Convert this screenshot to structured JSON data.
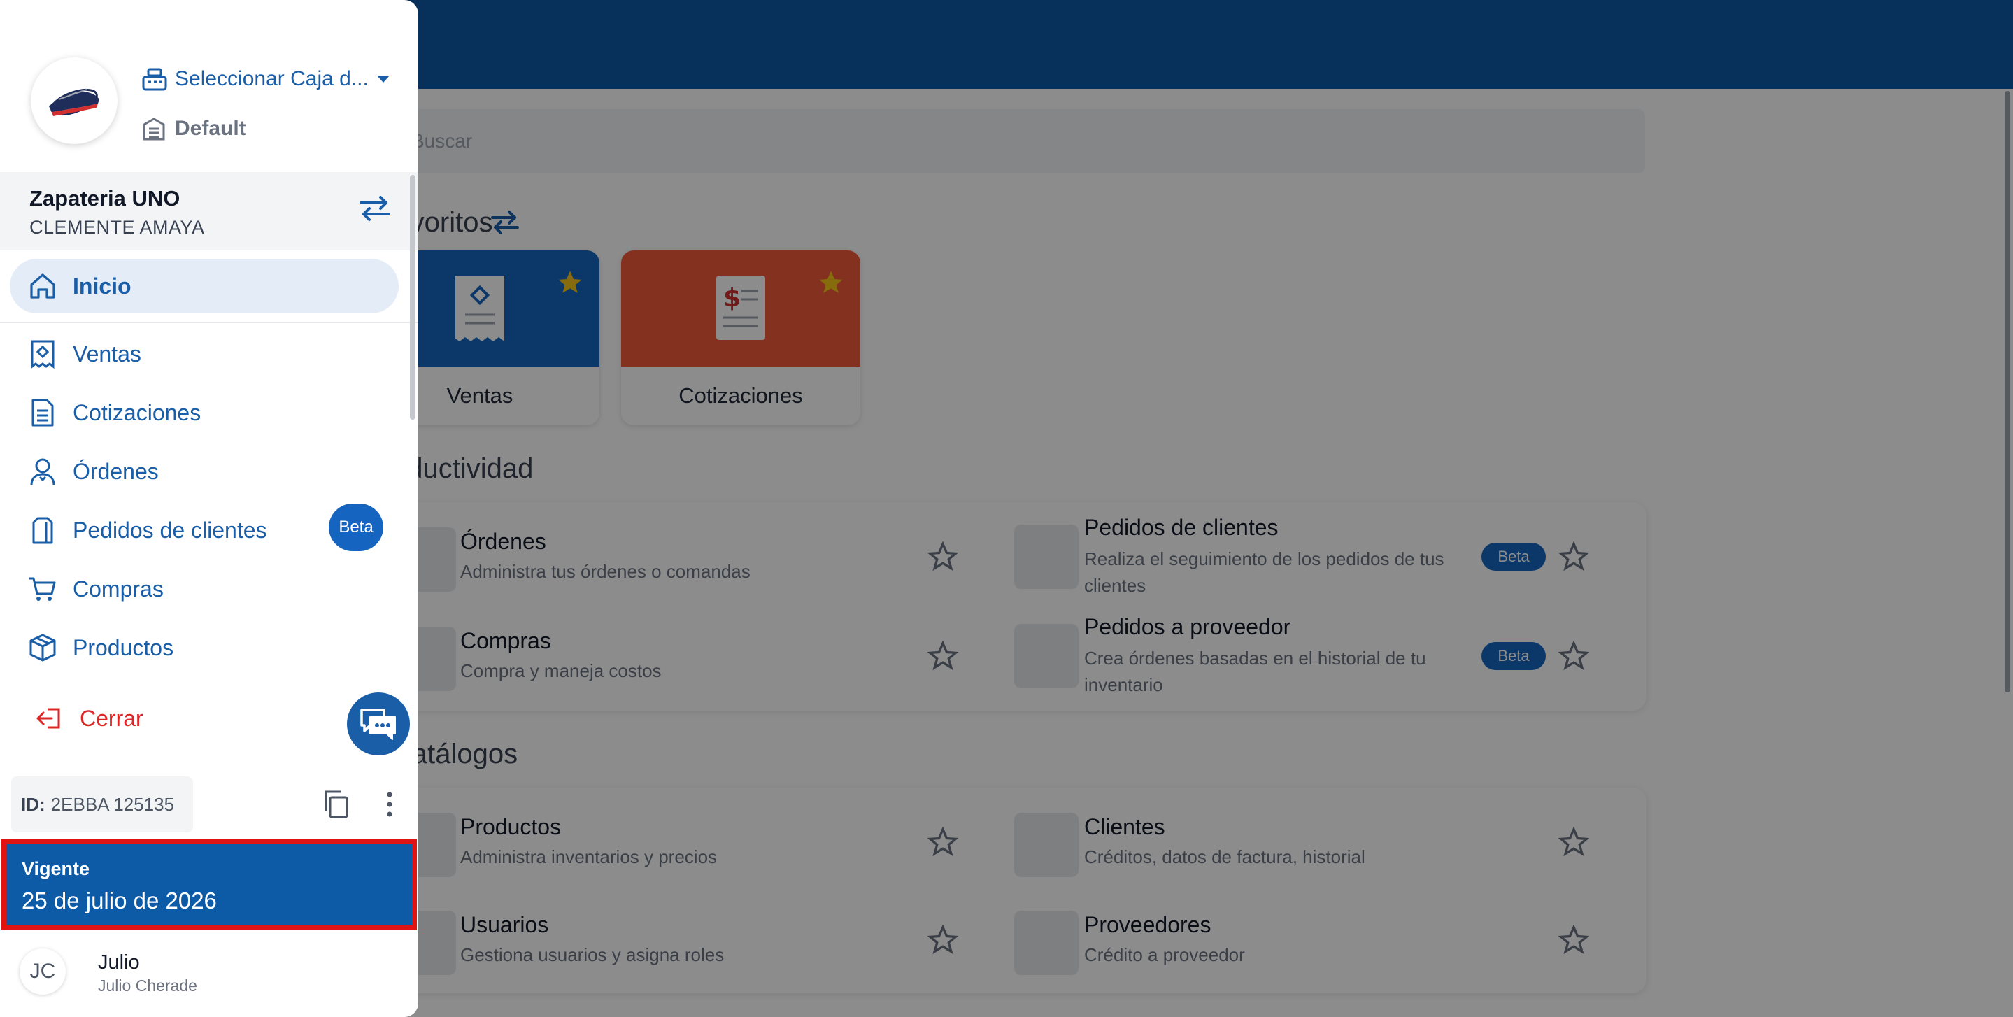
{
  "colors": {
    "primary": "#0d5aa7",
    "accent": "#1a5ea8",
    "danger": "#dc2626",
    "highlight": "#e11414"
  },
  "main": {
    "search_placeholder": "Buscar",
    "favoritos_title": "Favoritos",
    "favorites": [
      {
        "label": "Ventas",
        "color": "#1565c0",
        "icon": "receipt-icon"
      },
      {
        "label": "Cotizaciones",
        "color": "#f05a3a",
        "icon": "quote-doc-icon"
      }
    ],
    "productividad_title": "Productividad",
    "productividad": [
      {
        "title": "Órdenes",
        "desc": "Administra tus órdenes o comandas"
      },
      {
        "title": "Pedidos de clientes",
        "desc": "Realiza el seguimiento de los pedidos de tus clientes",
        "badge": "Beta"
      },
      {
        "title": "Compras",
        "desc": "Compra y maneja costos"
      },
      {
        "title": "Pedidos a proveedor",
        "desc": "Crea órdenes basadas en el historial de tu inventario",
        "badge": "Beta"
      }
    ],
    "catalogos_title": "Catálogos",
    "catalogos": [
      {
        "title": "Productos",
        "desc": "Administra inventarios y precios"
      },
      {
        "title": "Clientes",
        "desc": "Créditos, datos de factura, historial"
      },
      {
        "title": "Usuarios",
        "desc": "Gestiona usuarios y asigna roles"
      },
      {
        "title": "Proveedores",
        "desc": "Crédito a proveedor"
      }
    ]
  },
  "drawer": {
    "caja_select": "Seleccionar Caja d...",
    "default_label": "Default",
    "company_name": "Zapateria UNO",
    "company_user": "CLEMENTE AMAYA",
    "nav": [
      {
        "label": "Inicio",
        "icon": "home-icon",
        "active": true
      },
      {
        "label": "Ventas",
        "icon": "receipt-icon"
      },
      {
        "label": "Cotizaciones",
        "icon": "document-icon"
      },
      {
        "label": "Órdenes",
        "icon": "waiter-icon"
      },
      {
        "label": "Pedidos de clientes",
        "icon": "bag-icon",
        "badge": "Beta"
      },
      {
        "label": "Compras",
        "icon": "cart-icon"
      },
      {
        "label": "Productos",
        "icon": "box-icon"
      }
    ],
    "cerrar_label": "Cerrar",
    "id_label": "ID:",
    "id_value": "2EBBA 125135",
    "vigente_title": "Vigente",
    "vigente_date": "25 de julio de 2026",
    "user_initials": "JC",
    "user_name": "Julio",
    "user_full_name": "Julio Cherade"
  }
}
